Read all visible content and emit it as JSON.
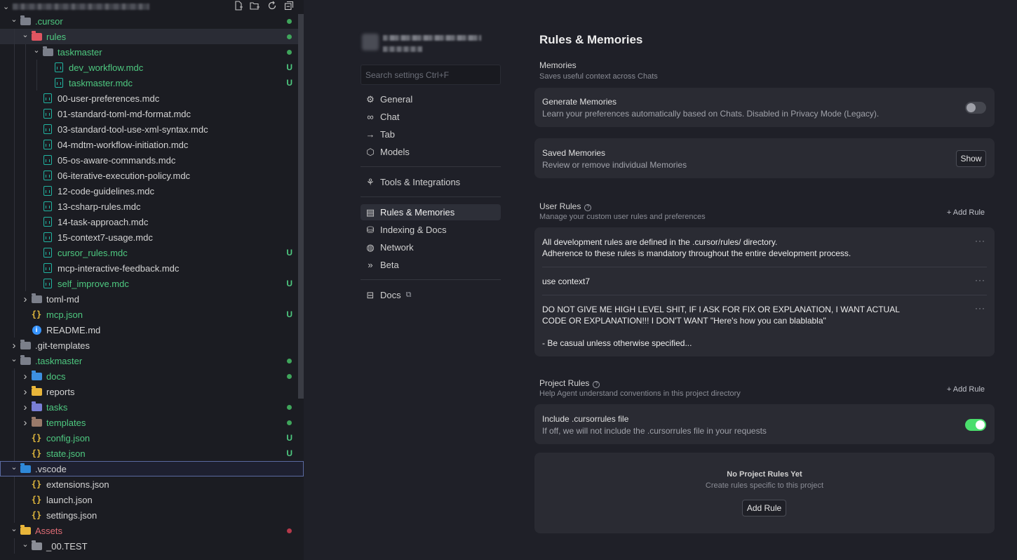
{
  "explorer": {
    "actions": [
      "new-file-icon",
      "new-folder-icon",
      "refresh-icon",
      "collapse-all-icon"
    ],
    "tree": [
      {
        "label": ".cursor",
        "depth": 1,
        "type": "folder-open",
        "chev": "down",
        "color": "green",
        "dot": "green"
      },
      {
        "label": "rules",
        "depth": 2,
        "type": "folder-rules",
        "chev": "down",
        "color": "green",
        "dot": "green",
        "active": true
      },
      {
        "label": "taskmaster",
        "depth": 3,
        "type": "folder-open",
        "chev": "down",
        "color": "green",
        "dot": "green"
      },
      {
        "label": "dev_workflow.mdc",
        "depth": 4,
        "type": "md",
        "color": "green",
        "status": "U"
      },
      {
        "label": "taskmaster.mdc",
        "depth": 4,
        "type": "md",
        "color": "green",
        "status": "U"
      },
      {
        "label": "00-user-preferences.mdc",
        "depth": 3,
        "type": "md",
        "color": "light"
      },
      {
        "label": "01-standard-toml-md-format.mdc",
        "depth": 3,
        "type": "md",
        "color": "light"
      },
      {
        "label": "03-standard-tool-use-xml-syntax.mdc",
        "depth": 3,
        "type": "md",
        "color": "light"
      },
      {
        "label": "04-mdtm-workflow-initiation.mdc",
        "depth": 3,
        "type": "md",
        "color": "light"
      },
      {
        "label": "05-os-aware-commands.mdc",
        "depth": 3,
        "type": "md",
        "color": "light"
      },
      {
        "label": "06-iterative-execution-policy.mdc",
        "depth": 3,
        "type": "md",
        "color": "light"
      },
      {
        "label": "12-code-guidelines.mdc",
        "depth": 3,
        "type": "md",
        "color": "light"
      },
      {
        "label": "13-csharp-rules.mdc",
        "depth": 3,
        "type": "md",
        "color": "light"
      },
      {
        "label": "14-task-approach.mdc",
        "depth": 3,
        "type": "md",
        "color": "light"
      },
      {
        "label": "15-context7-usage.mdc",
        "depth": 3,
        "type": "md",
        "color": "light"
      },
      {
        "label": "cursor_rules.mdc",
        "depth": 3,
        "type": "md",
        "color": "green",
        "status": "U"
      },
      {
        "label": "mcp-interactive-feedback.mdc",
        "depth": 3,
        "type": "md",
        "color": "light"
      },
      {
        "label": "self_improve.mdc",
        "depth": 3,
        "type": "md",
        "color": "green",
        "status": "U"
      },
      {
        "label": "toml-md",
        "depth": 2,
        "type": "folder",
        "chev": "right",
        "color": "light"
      },
      {
        "label": "mcp.json",
        "depth": 2,
        "type": "json",
        "color": "green",
        "status": "U"
      },
      {
        "label": "README.md",
        "depth": 2,
        "type": "info",
        "color": "light"
      },
      {
        "label": ".git-templates",
        "depth": 1,
        "type": "folder",
        "chev": "right",
        "color": "light"
      },
      {
        "label": ".taskmaster",
        "depth": 1,
        "type": "folder-open",
        "chev": "down",
        "color": "green",
        "dot": "green"
      },
      {
        "label": "docs",
        "depth": 2,
        "type": "folder-docs",
        "chev": "right",
        "color": "green",
        "dot": "green"
      },
      {
        "label": "reports",
        "depth": 2,
        "type": "folder-yellow",
        "chev": "right",
        "color": "light"
      },
      {
        "label": "tasks",
        "depth": 2,
        "type": "folder-tasks",
        "chev": "right",
        "color": "green",
        "dot": "green"
      },
      {
        "label": "templates",
        "depth": 2,
        "type": "folder-templates",
        "chev": "right",
        "color": "green",
        "dot": "green"
      },
      {
        "label": "config.json",
        "depth": 2,
        "type": "json",
        "color": "green",
        "status": "U"
      },
      {
        "label": "state.json",
        "depth": 2,
        "type": "json",
        "color": "green",
        "status": "U"
      },
      {
        "label": ".vscode",
        "depth": 1,
        "type": "folder-vscode",
        "chev": "down",
        "color": "light",
        "selected": true
      },
      {
        "label": "extensions.json",
        "depth": 2,
        "type": "json",
        "color": "light"
      },
      {
        "label": "launch.json",
        "depth": 2,
        "type": "json",
        "color": "light"
      },
      {
        "label": "settings.json",
        "depth": 2,
        "type": "json",
        "color": "light"
      },
      {
        "label": "Assets",
        "depth": 1,
        "type": "folder-yellow-open",
        "chev": "down",
        "color": "red",
        "dot": "red"
      },
      {
        "label": "_00.TEST",
        "depth": 2,
        "type": "folder-open-grey",
        "chev": "down",
        "color": "light"
      }
    ]
  },
  "settings": {
    "search_placeholder": "Search settings Ctrl+F",
    "nav_groups": [
      [
        {
          "label": "General",
          "icon": "gear-icon",
          "glyph": "⚙"
        },
        {
          "label": "Chat",
          "icon": "infinity-icon",
          "glyph": "∞"
        },
        {
          "label": "Tab",
          "icon": "arrow-right-icon",
          "glyph": "→"
        },
        {
          "label": "Models",
          "icon": "cube-icon",
          "glyph": "⬡"
        }
      ],
      [
        {
          "label": "Tools & Integrations",
          "icon": "tools-icon",
          "glyph": "⚘"
        }
      ],
      [
        {
          "label": "Rules & Memories",
          "icon": "clipboard-icon",
          "glyph": "▤",
          "active": true
        },
        {
          "label": "Indexing & Docs",
          "icon": "database-icon",
          "glyph": "⛁"
        },
        {
          "label": "Network",
          "icon": "globe-icon",
          "glyph": "◍"
        },
        {
          "label": "Beta",
          "icon": "chevrons-right-icon",
          "glyph": "»"
        }
      ],
      [
        {
          "label": "Docs",
          "icon": "book-icon",
          "glyph": "⊟",
          "external": true
        }
      ]
    ]
  },
  "content": {
    "page_title": "Rules & Memories",
    "memories": {
      "title": "Memories",
      "desc": "Saves useful context across Chats",
      "generate": {
        "title": "Generate Memories",
        "desc": "Learn your preferences automatically based on Chats. Disabled in Privacy Mode (Legacy).",
        "enabled": false
      },
      "saved": {
        "title": "Saved Memories",
        "desc": "Review or remove individual Memories",
        "button": "Show"
      }
    },
    "user_rules": {
      "title": "User Rules",
      "desc": "Manage your custom user rules and preferences",
      "add_label": "+ Add Rule",
      "rules": [
        "All development rules are defined in the .cursor/rules/ directory.\nAdherence to these rules is mandatory throughout the entire development process.",
        "use context7",
        "DO NOT GIVE ME HIGH LEVEL SHIT, IF I ASK FOR FIX OR EXPLANATION, I WANT ACTUAL CODE OR EXPLANATION!!! I DON'T WANT \"Here's how you can blablabla\"\n\n- Be casual unless otherwise specified..."
      ],
      "more_label": "···"
    },
    "project_rules": {
      "title": "Project Rules",
      "desc": "Help Agent understand conventions in this project directory",
      "add_label": "+ Add Rule",
      "include": {
        "title": "Include .cursorrules file",
        "desc": "If off, we will not include the .cursorrules file in your requests",
        "enabled": true
      },
      "empty": {
        "title": "No Project Rules Yet",
        "desc": "Create rules specific to this project",
        "button": "Add Rule"
      }
    }
  },
  "colors": {
    "accent_green": "#4ade6c",
    "git_untracked": "#4ec980",
    "git_error": "#e06c75",
    "card_bg": "#2a2b33"
  }
}
